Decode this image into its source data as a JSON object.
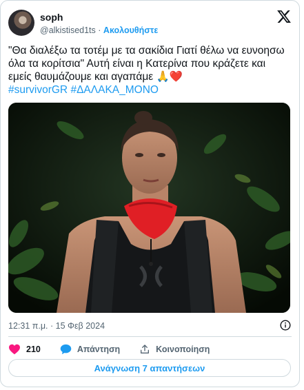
{
  "author": {
    "display_name": "soph",
    "handle": "@alkistised1ts",
    "separator": "·",
    "follow_label": "Ακολουθήστε"
  },
  "tweet": {
    "text": "\"Θα διαλέξω τα τοτέμ με τα σακίδια Γιατί θέλω να ευνοησω όλα τα κορίτσια\" Αυτή είναι η Κατερίνα που κράζετε και εμείς θαυμάζουμε και αγαπάμε",
    "emojis": "🙏❤️",
    "hashtags": [
      "#survivorGR",
      "#ΔΑΛΑΚΑ_ΜΟΝΟ"
    ],
    "timestamp": "12:31 π.μ. · 15 Φεβ 2024"
  },
  "actions": {
    "like_count": "210",
    "reply_label": "Απάντηση",
    "share_label": "Κοινοποίηση"
  },
  "read_replies_label": "Ανάγνωση 7 απαντήσεων",
  "icons": {
    "logo": "x-logo-icon",
    "info": "info-icon",
    "like": "heart-icon",
    "reply": "speech-bubble-icon",
    "share": "share-upload-icon"
  },
  "colors": {
    "link": "#1d9bf0",
    "like": "#f91880",
    "muted": "#536471",
    "border": "#cfd9de"
  }
}
